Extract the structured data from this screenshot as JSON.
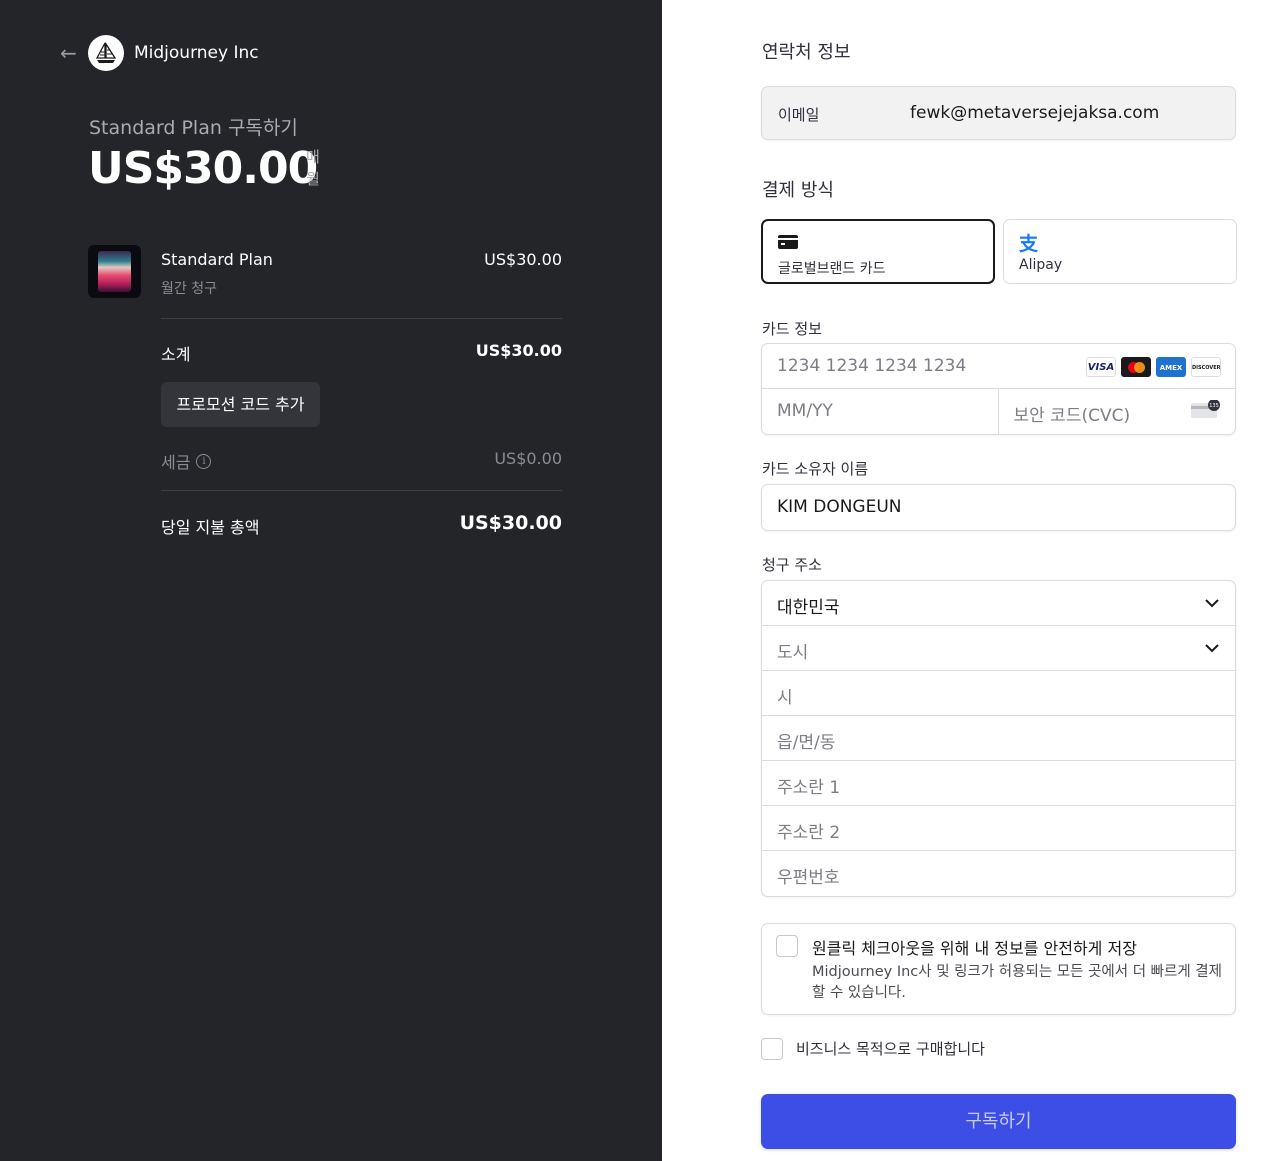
{
  "merchant": {
    "name": "Midjourney Inc"
  },
  "summary": {
    "subtitle": "Standard Plan 구독하기",
    "price": "US$30.00",
    "period": "매월"
  },
  "line_item": {
    "name": "Standard Plan",
    "billing": "월간 청구",
    "price": "US$30.00"
  },
  "totals": {
    "subtotal_label": "소계",
    "subtotal_value": "US$30.00",
    "promo_button": "프로모션 코드 추가",
    "tax_label": "세금",
    "tax_value": "US$0.00",
    "total_label": "당일 지불 총액",
    "total_value": "US$30.00"
  },
  "contact": {
    "title": "연락처 정보",
    "email_label": "이메일",
    "email_value": "fewk@metaversejejaksa.com"
  },
  "payment": {
    "title": "결제 방식",
    "tabs": [
      {
        "label": "글로벌브랜드 카드",
        "icon": "credit-card-icon",
        "selected": true
      },
      {
        "label": "Alipay",
        "icon": "alipay-icon",
        "selected": false
      }
    ]
  },
  "card": {
    "label": "카드 정보",
    "number_placeholder": "1234 1234 1234 1234",
    "expiry_placeholder": "MM/YY",
    "cvc_placeholder": "보안 코드(CVC)",
    "brands": [
      "VISA",
      "mastercard",
      "AMEX",
      "DISCOVER"
    ]
  },
  "cardholder": {
    "label": "카드 소유자 이름",
    "value": "KIM DONGEUN"
  },
  "billing": {
    "label": "청구 주소",
    "country": "대한민국",
    "province_placeholder": "도시",
    "city_placeholder": "시",
    "district_placeholder": "읍/면/동",
    "address1_placeholder": "주소란 1",
    "address2_placeholder": "주소란 2",
    "postal_placeholder": "우편번호"
  },
  "save_info": {
    "title": "원클릭 체크아웃을 위해 내 정보를 안전하게 저장",
    "description": "Midjourney Inc사 및 링크가 허용되는 모든 곳에서 더 빠르게 결제할 수 있습니다.",
    "checked": false
  },
  "business": {
    "label": "비즈니스 목적으로 구매합니다",
    "checked": false
  },
  "submit": {
    "label": "구독하기"
  },
  "colors": {
    "left_bg": "#242529",
    "accent": "#3d4ee6",
    "alipay": "#1677ff"
  }
}
